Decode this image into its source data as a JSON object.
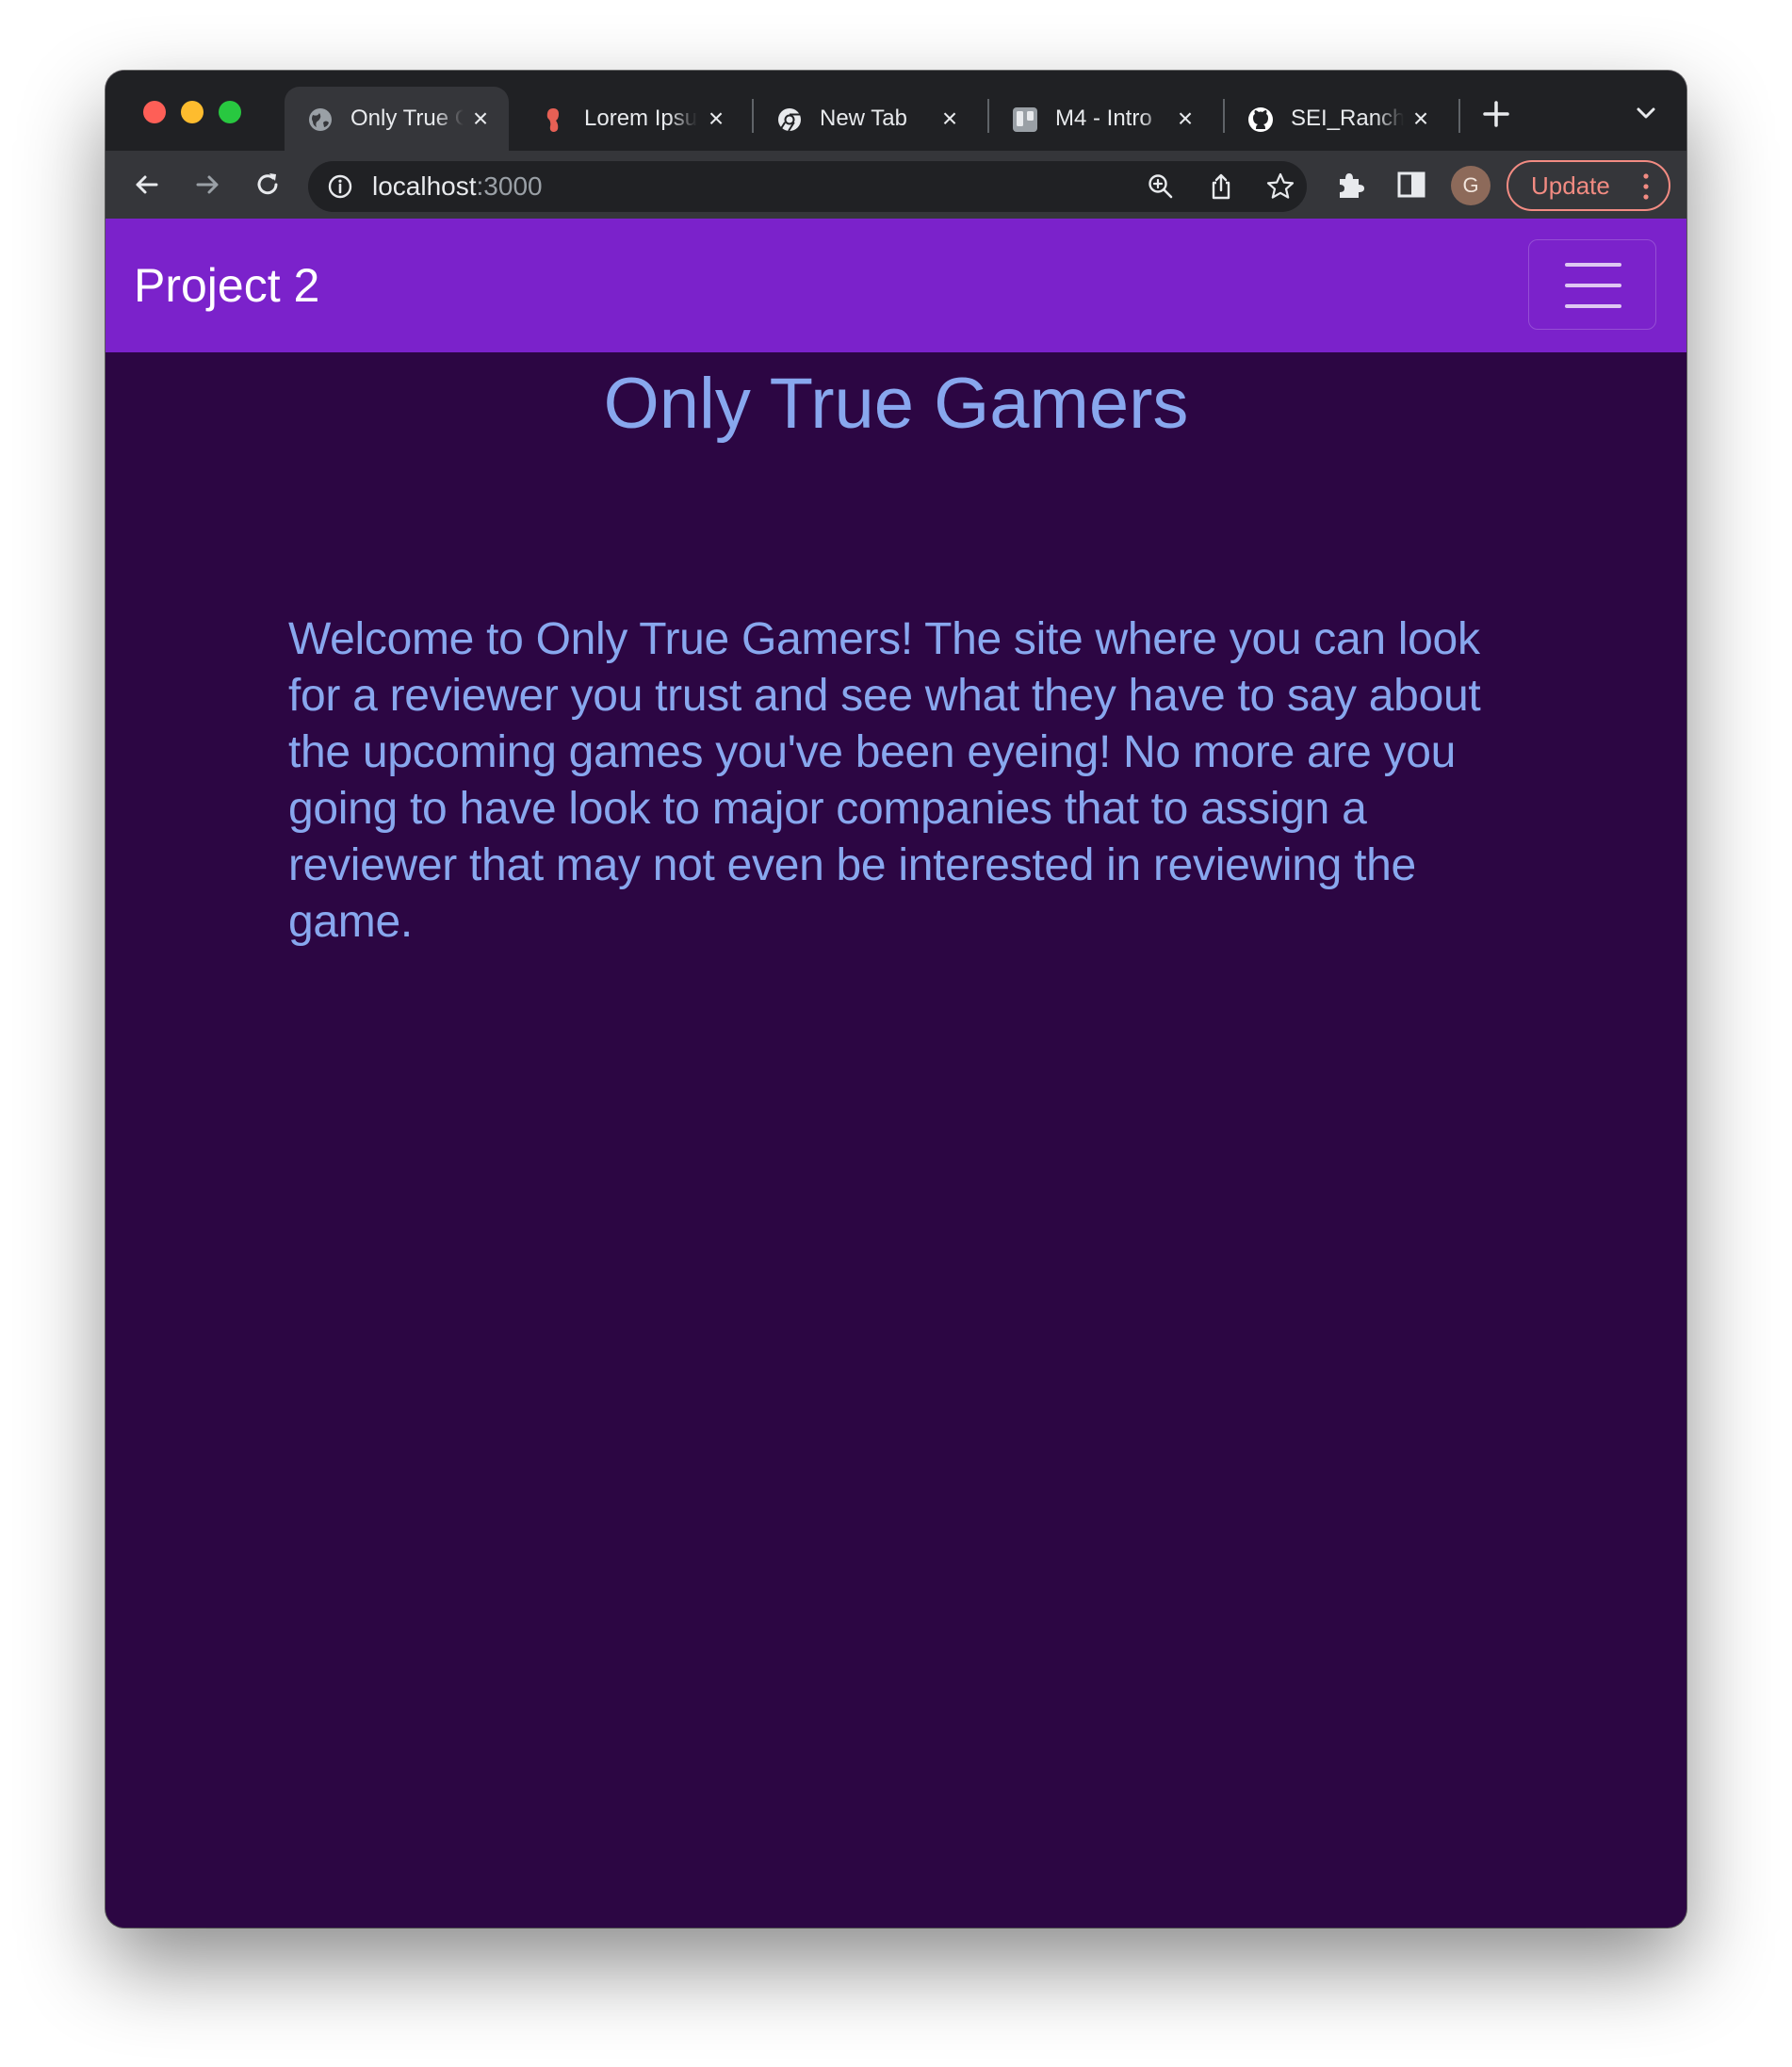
{
  "browser": {
    "tabs": [
      {
        "title": "Only True Gamers",
        "icon": "globe-icon",
        "active": true
      },
      {
        "title": "Lorem Ipsum",
        "icon": "lorem-ipsum-icon",
        "active": false
      },
      {
        "title": "New Tab",
        "icon": "chrome-icon",
        "active": false
      },
      {
        "title": "M4 - Intro",
        "icon": "trello-icon",
        "active": false
      },
      {
        "title": "SEI_Ranch",
        "icon": "github-icon",
        "active": false
      }
    ],
    "url_host": "localhost",
    "url_port": ":3000",
    "profile_initial": "G",
    "update_label": "Update",
    "colors": {
      "frame": "#202124",
      "toolbar": "#35363a",
      "update_accent": "#f28b82"
    }
  },
  "navbar": {
    "brand": "Project 2",
    "color": "#7b22cb"
  },
  "main": {
    "title": "Only True Gamers",
    "welcome": "Welcome to Only True Gamers! The site where you can look for a reviewer you trust and see what they have to say about the upcoming games you've been eyeing! No more are you going to have look to major companies that to assign a reviewer that may not even be interested in reviewing the game.",
    "background": "#2c0643",
    "text_color": "#88a7ee"
  }
}
